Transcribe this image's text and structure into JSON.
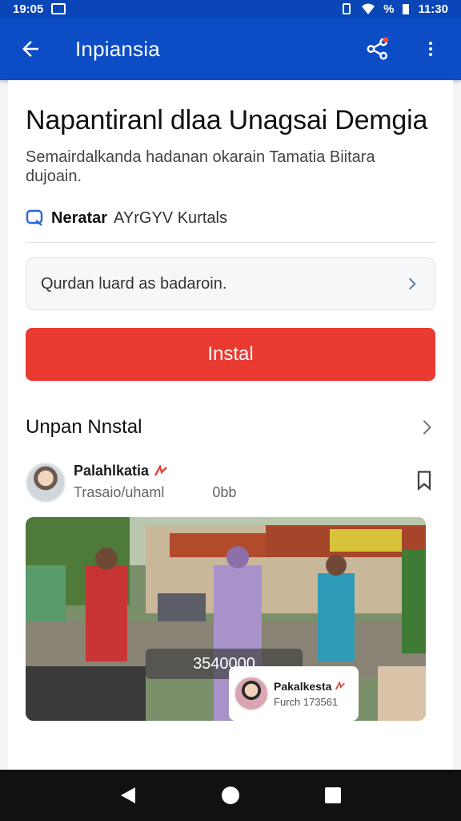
{
  "status_bar": {
    "time_left": "19:05",
    "battery_text": "%",
    "time_right": "11:30"
  },
  "app_bar": {
    "title": "Inpiansia",
    "icons": [
      "back-arrow-icon",
      "share-icon",
      "more-vert-icon"
    ]
  },
  "page": {
    "heading": "Napantiranl dlaa Unagsai Demgia",
    "description": "Semairdalkanda hadanan okarain Tamatia Biitara dujoain.",
    "reviews": {
      "bold": "Neratar",
      "rest": "AYrGYV Kurtals"
    },
    "field": {
      "text": "Qurdan luard as badaroin."
    },
    "install_label": "Instal",
    "section_title": "Unpan Nnstal"
  },
  "post": {
    "author": "Palahlkatia",
    "sub_left": "Trasaio/uhaml",
    "sub_right": "0bb",
    "photo_caption": "3540000",
    "mini_card": {
      "name": "Pakalkesta",
      "detail": "Furch 173561"
    }
  },
  "colors": {
    "appbar": "#0c4cc4",
    "install": "#e83a31",
    "navbar": "#111111"
  }
}
